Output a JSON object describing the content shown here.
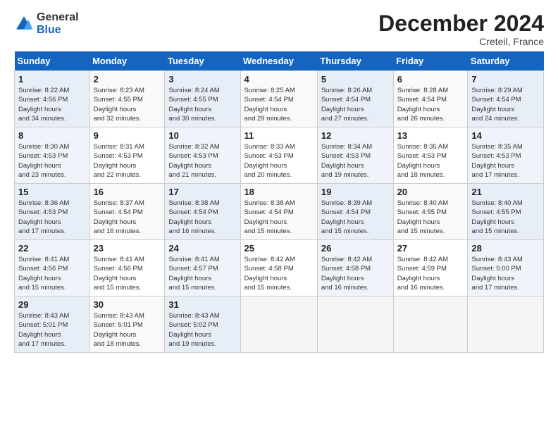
{
  "logo": {
    "line1": "General",
    "line2": "Blue"
  },
  "title": "December 2024",
  "location": "Creteil, France",
  "days_of_week": [
    "Sunday",
    "Monday",
    "Tuesday",
    "Wednesday",
    "Thursday",
    "Friday",
    "Saturday"
  ],
  "weeks": [
    [
      {
        "day": "1",
        "sunrise": "8:22 AM",
        "sunset": "4:56 PM",
        "daylight": "8 hours and 34 minutes."
      },
      {
        "day": "2",
        "sunrise": "8:23 AM",
        "sunset": "4:55 PM",
        "daylight": "8 hours and 32 minutes."
      },
      {
        "day": "3",
        "sunrise": "8:24 AM",
        "sunset": "4:55 PM",
        "daylight": "8 hours and 30 minutes."
      },
      {
        "day": "4",
        "sunrise": "8:25 AM",
        "sunset": "4:54 PM",
        "daylight": "8 hours and 29 minutes."
      },
      {
        "day": "5",
        "sunrise": "8:26 AM",
        "sunset": "4:54 PM",
        "daylight": "8 hours and 27 minutes."
      },
      {
        "day": "6",
        "sunrise": "8:28 AM",
        "sunset": "4:54 PM",
        "daylight": "8 hours and 26 minutes."
      },
      {
        "day": "7",
        "sunrise": "8:29 AM",
        "sunset": "4:54 PM",
        "daylight": "8 hours and 24 minutes."
      }
    ],
    [
      {
        "day": "8",
        "sunrise": "8:30 AM",
        "sunset": "4:53 PM",
        "daylight": "8 hours and 23 minutes."
      },
      {
        "day": "9",
        "sunrise": "8:31 AM",
        "sunset": "4:53 PM",
        "daylight": "8 hours and 22 minutes."
      },
      {
        "day": "10",
        "sunrise": "8:32 AM",
        "sunset": "4:53 PM",
        "daylight": "8 hours and 21 minutes."
      },
      {
        "day": "11",
        "sunrise": "8:33 AM",
        "sunset": "4:53 PM",
        "daylight": "8 hours and 20 minutes."
      },
      {
        "day": "12",
        "sunrise": "8:34 AM",
        "sunset": "4:53 PM",
        "daylight": "8 hours and 19 minutes."
      },
      {
        "day": "13",
        "sunrise": "8:35 AM",
        "sunset": "4:53 PM",
        "daylight": "8 hours and 18 minutes."
      },
      {
        "day": "14",
        "sunrise": "8:35 AM",
        "sunset": "4:53 PM",
        "daylight": "8 hours and 17 minutes."
      }
    ],
    [
      {
        "day": "15",
        "sunrise": "8:36 AM",
        "sunset": "4:53 PM",
        "daylight": "8 hours and 17 minutes."
      },
      {
        "day": "16",
        "sunrise": "8:37 AM",
        "sunset": "4:54 PM",
        "daylight": "8 hours and 16 minutes."
      },
      {
        "day": "17",
        "sunrise": "8:38 AM",
        "sunset": "4:54 PM",
        "daylight": "8 hours and 16 minutes."
      },
      {
        "day": "18",
        "sunrise": "8:38 AM",
        "sunset": "4:54 PM",
        "daylight": "8 hours and 15 minutes."
      },
      {
        "day": "19",
        "sunrise": "8:39 AM",
        "sunset": "4:54 PM",
        "daylight": "8 hours and 15 minutes."
      },
      {
        "day": "20",
        "sunrise": "8:40 AM",
        "sunset": "4:55 PM",
        "daylight": "8 hours and 15 minutes."
      },
      {
        "day": "21",
        "sunrise": "8:40 AM",
        "sunset": "4:55 PM",
        "daylight": "8 hours and 15 minutes."
      }
    ],
    [
      {
        "day": "22",
        "sunrise": "8:41 AM",
        "sunset": "4:56 PM",
        "daylight": "8 hours and 15 minutes."
      },
      {
        "day": "23",
        "sunrise": "8:41 AM",
        "sunset": "4:56 PM",
        "daylight": "8 hours and 15 minutes."
      },
      {
        "day": "24",
        "sunrise": "8:41 AM",
        "sunset": "4:57 PM",
        "daylight": "8 hours and 15 minutes."
      },
      {
        "day": "25",
        "sunrise": "8:42 AM",
        "sunset": "4:58 PM",
        "daylight": "8 hours and 15 minutes."
      },
      {
        "day": "26",
        "sunrise": "8:42 AM",
        "sunset": "4:58 PM",
        "daylight": "8 hours and 16 minutes."
      },
      {
        "day": "27",
        "sunrise": "8:42 AM",
        "sunset": "4:59 PM",
        "daylight": "8 hours and 16 minutes."
      },
      {
        "day": "28",
        "sunrise": "8:43 AM",
        "sunset": "5:00 PM",
        "daylight": "8 hours and 17 minutes."
      }
    ],
    [
      {
        "day": "29",
        "sunrise": "8:43 AM",
        "sunset": "5:01 PM",
        "daylight": "8 hours and 17 minutes."
      },
      {
        "day": "30",
        "sunrise": "8:43 AM",
        "sunset": "5:01 PM",
        "daylight": "8 hours and 18 minutes."
      },
      {
        "day": "31",
        "sunrise": "8:43 AM",
        "sunset": "5:02 PM",
        "daylight": "8 hours and 19 minutes."
      },
      null,
      null,
      null,
      null
    ]
  ]
}
